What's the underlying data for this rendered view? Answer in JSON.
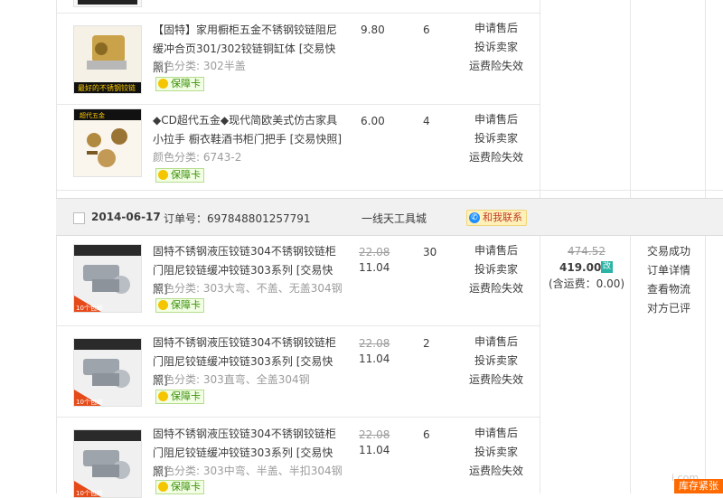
{
  "order_header": {
    "date": "2014-06-17",
    "order_no": "订单号：697848801257791",
    "shop": "一线天工具城",
    "contact_label": "和我联系"
  },
  "items": [
    {
      "title": "【固特】家用橱柜五金不锈钢铰链阻尼缓冲合页301/302铰链铜缸体",
      "snapshot": "[交易快照]",
      "variant": "颜色分类: 302半盖",
      "badge": "保障卡",
      "price": "9.80",
      "qty": "6",
      "actions": [
        "申请售后",
        "投诉卖家",
        "运费险失效"
      ],
      "thumb_caption": "最好的不锈钢铰链"
    },
    {
      "title": "◆CD超代五金◆现代简欧美式仿古家具小拉手 橱衣鞋酒书柜门把手",
      "snapshot": "[交易快照]",
      "variant": "颜色分类: 6743-2",
      "badge": "保障卡",
      "price": "6.00",
      "qty": "4",
      "actions": [
        "申请售后",
        "投诉卖家",
        "运费险失效"
      ],
      "thumb_caption": "超代五金"
    },
    {
      "title": "固特不锈钢液压铰链304不锈钢铰链柜门阻尼铰链缓冲铰链303系列",
      "snapshot": "[交易快照]",
      "variant": "颜色分类: 303大弯、不盖、无盖304钢",
      "badge": "保障卡",
      "price_old": "22.08",
      "price_new": "11.04",
      "qty": "30",
      "actions": [
        "申请售后",
        "投诉卖家",
        "运费险失效"
      ],
      "thumb_caption": "10个包邮"
    },
    {
      "title": "固特不锈钢液压铰链304不锈钢铰链柜门阻尼铰链缓冲铰链303系列",
      "snapshot": "[交易快照]",
      "variant": "颜色分类: 303直弯、全盖304钢",
      "badge": "保障卡",
      "price_old": "22.08",
      "price_new": "11.04",
      "qty": "2",
      "actions": [
        "申请售后",
        "投诉卖家",
        "运费险失效"
      ],
      "thumb_caption": "10个包邮"
    },
    {
      "title": "固特不锈钢液压铰链304不锈钢铰链柜门阻尼铰链缓冲铰链303系列",
      "snapshot": "[交易快照]",
      "variant": "颜色分类: 303中弯、半盖、半扣304钢",
      "badge": "保障卡",
      "price_old": "22.08",
      "price_new": "11.04",
      "qty": "6",
      "actions": [
        "申请售后",
        "投诉卖家",
        "运费险失效"
      ],
      "thumb_caption": "10个包邮"
    }
  ],
  "order_total": {
    "old": "474.52",
    "new": "419.00",
    "pay_tag": "改",
    "shipping": "(含运费：0.00)"
  },
  "order_status": [
    "交易成功",
    "订单详情",
    "查看物流",
    "对方已评"
  ],
  "floating": {
    "logo_text": "i.com",
    "stock_button": "库存紧张"
  },
  "colors": {
    "header_bg": "#f1f1f1",
    "badge_green": "#3c8f0a",
    "contact_bg": "#fff1b8",
    "stock_orange": "#ff6a00"
  }
}
